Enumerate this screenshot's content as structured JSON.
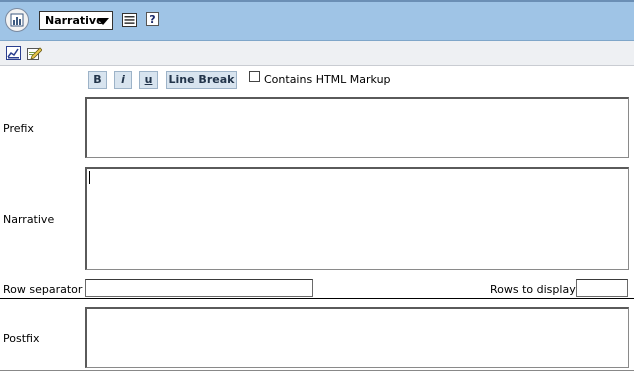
{
  "header": {
    "view_selected": "Narrative",
    "icons": [
      "report-view-icon",
      "properties-icon",
      "help-icon"
    ]
  },
  "toolbar": {
    "icons": [
      "edit-graph-icon",
      "edit-pen-icon"
    ]
  },
  "format": {
    "bold": "B",
    "italic": "i",
    "underline": "u",
    "line_break": "Line Break",
    "html_checkbox_label": "Contains HTML Markup",
    "html_checked": false
  },
  "form": {
    "prefix_label": "Prefix",
    "prefix_value": "",
    "narrative_label": "Narrative",
    "narrative_value": "",
    "row_separator_label": "Row separator",
    "row_separator_value": "",
    "rows_to_display_label": "Rows to display",
    "rows_to_display_value": "",
    "postfix_label": "Postfix",
    "postfix_value": ""
  }
}
